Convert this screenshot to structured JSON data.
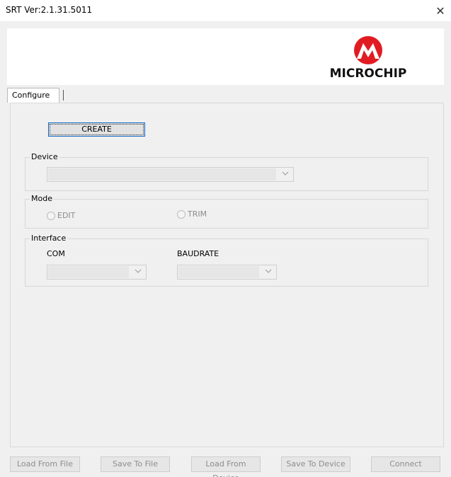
{
  "window": {
    "title": "SRT Ver:2.1.31.5011",
    "close_glyph": "✕"
  },
  "logo": {
    "name": "MICROCHIP",
    "brand_color": "#e11b22"
  },
  "tabs": [
    {
      "label": "Configure",
      "active": true
    }
  ],
  "configure": {
    "create_label": "CREATE",
    "device": {
      "group_label": "Device",
      "selected": ""
    },
    "mode": {
      "group_label": "Mode",
      "options": [
        "EDIT",
        "TRIM"
      ]
    },
    "interface": {
      "group_label": "Interface",
      "com_label": "COM",
      "com_selected": "",
      "baud_label": "BAUDRATE",
      "baud_selected": ""
    }
  },
  "footer": {
    "buttons": [
      "Load From File",
      "Save To File",
      "Load From Device",
      "Save To Device",
      "Connect"
    ]
  },
  "icons": {
    "dropdown": "chevron-down-icon",
    "close": "close-icon"
  }
}
